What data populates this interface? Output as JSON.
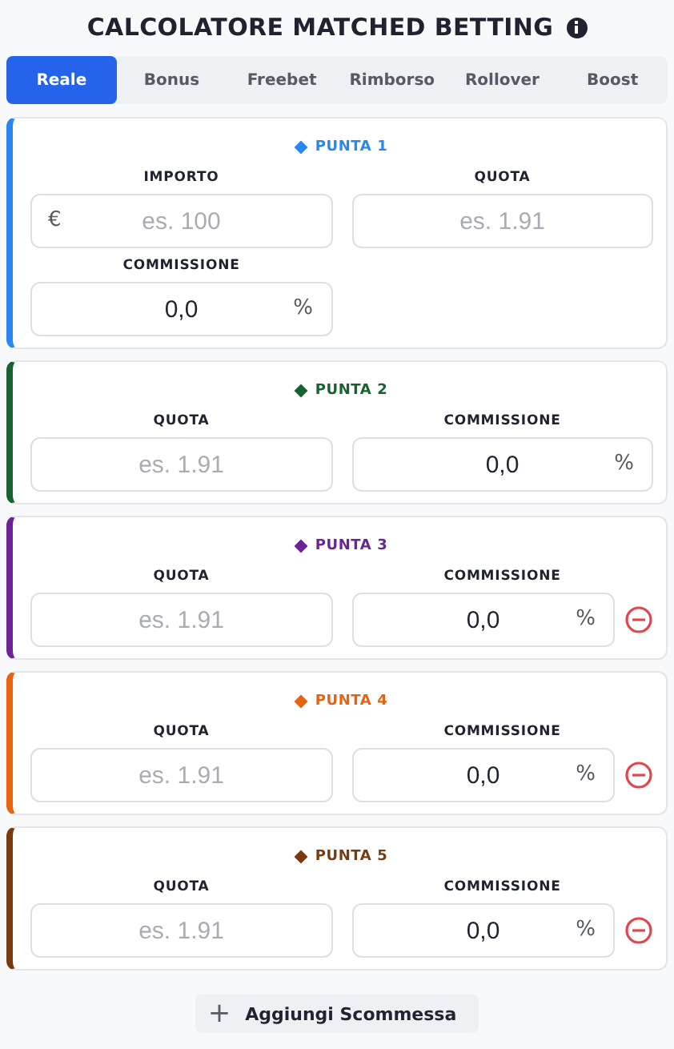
{
  "title": "CALCOLATORE MATCHED BETTING",
  "tabs": [
    {
      "label": "Reale",
      "selected": true
    },
    {
      "label": "Bonus",
      "selected": false
    },
    {
      "label": "Freebet",
      "selected": false
    },
    {
      "label": "Rimborso",
      "selected": false
    },
    {
      "label": "Rollover",
      "selected": false
    },
    {
      "label": "Boost",
      "selected": false
    }
  ],
  "bets": [
    {
      "title": "PUNTA 1",
      "color": "#2b87f0",
      "removable": false,
      "fields": [
        {
          "label": "IMPORTO",
          "prefix": "€",
          "placeholder": "es. 100"
        },
        {
          "label": "QUOTA",
          "placeholder": "es. 1.91"
        },
        {
          "label": "COMMISSIONE",
          "value": "0,0",
          "suffix": "%"
        }
      ]
    },
    {
      "title": "PUNTA 2",
      "color": "#16632e",
      "removable": false,
      "fields": [
        {
          "label": "QUOTA",
          "placeholder": "es. 1.91"
        },
        {
          "label": "COMMISSIONE",
          "value": "0,0",
          "suffix": "%"
        }
      ]
    },
    {
      "title": "PUNTA 3",
      "color": "#6b2397",
      "removable": true,
      "fields": [
        {
          "label": "QUOTA",
          "placeholder": "es. 1.91"
        },
        {
          "label": "COMMISSIONE",
          "value": "0,0",
          "suffix": "%"
        }
      ]
    },
    {
      "title": "PUNTA 4",
      "color": "#e8620f",
      "removable": true,
      "fields": [
        {
          "label": "QUOTA",
          "placeholder": "es. 1.91"
        },
        {
          "label": "COMMISSIONE",
          "value": "0,0",
          "suffix": "%"
        }
      ]
    },
    {
      "title": "PUNTA 5",
      "color": "#7a3a10",
      "removable": true,
      "fields": [
        {
          "label": "QUOTA",
          "placeholder": "es. 1.91"
        },
        {
          "label": "COMMISSIONE",
          "value": "0,0",
          "suffix": "%"
        }
      ]
    }
  ],
  "add_button": {
    "icon": "+",
    "label": "Aggiungi Scommessa"
  }
}
